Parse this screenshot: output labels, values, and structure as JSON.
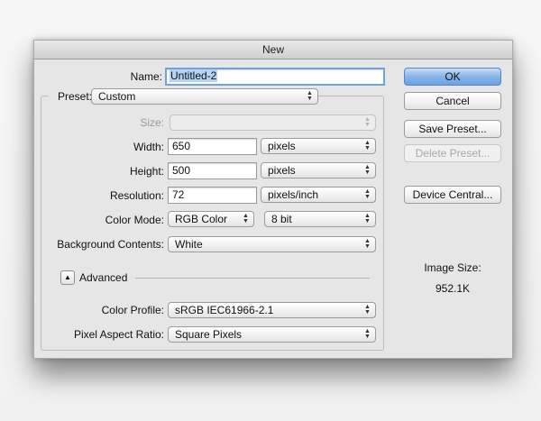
{
  "dialog": {
    "title": "New"
  },
  "form": {
    "name_label": "Name:",
    "name_value": "Untitled-2",
    "preset_label": "Preset:",
    "preset_value": "Custom",
    "size_label": "Size:",
    "size_value": "",
    "width_label": "Width:",
    "width_value": "650",
    "width_unit": "pixels",
    "height_label": "Height:",
    "height_value": "500",
    "height_unit": "pixels",
    "resolution_label": "Resolution:",
    "resolution_value": "72",
    "resolution_unit": "pixels/inch",
    "color_mode_label": "Color Mode:",
    "color_mode_value": "RGB Color",
    "bit_depth_value": "8 bit",
    "background_label": "Background Contents:",
    "background_value": "White",
    "advanced_label": "Advanced",
    "color_profile_label": "Color Profile:",
    "color_profile_value": "sRGB IEC61966-2.1",
    "pixel_aspect_label": "Pixel Aspect Ratio:",
    "pixel_aspect_value": "Square Pixels"
  },
  "buttons": {
    "ok": "OK",
    "cancel": "Cancel",
    "save_preset": "Save Preset...",
    "delete_preset": "Delete Preset...",
    "device_central": "Device Central..."
  },
  "info": {
    "image_size_label": "Image Size:",
    "image_size_value": "952.1K"
  },
  "icons": {
    "popup_arrows": "up-down-chevron-icon",
    "disclosure": "disclosure-triangle-icon"
  },
  "colors": {
    "primary_button": "#6aa1e3",
    "focus_ring": "#6fa2e0",
    "dialog_bg": "#e6e6e6"
  }
}
